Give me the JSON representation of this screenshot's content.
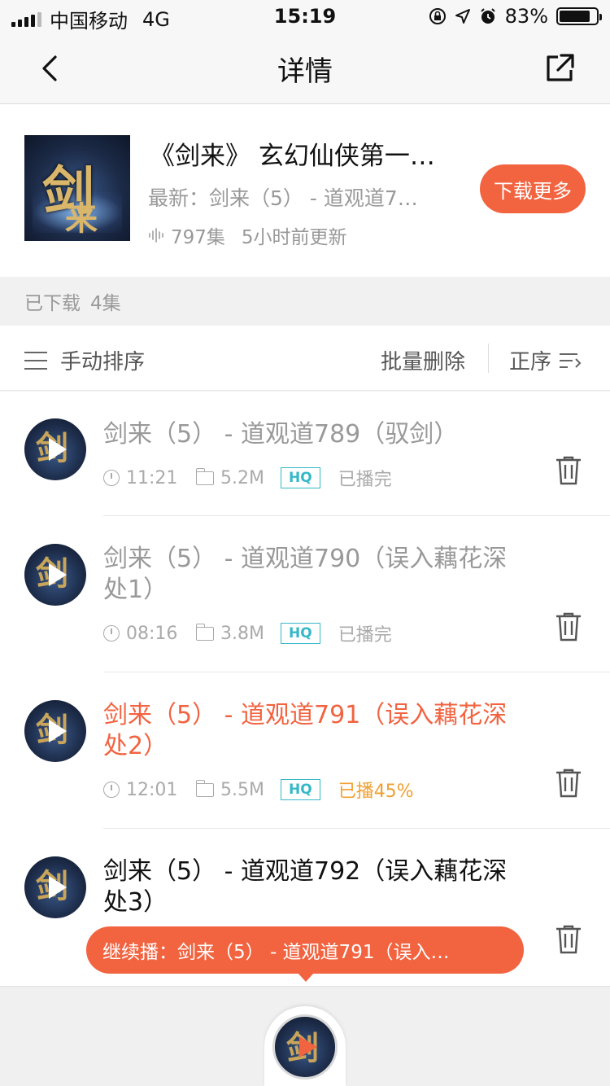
{
  "status_bar": {
    "carrier": "中国移动",
    "network": "4G",
    "time": "15:19",
    "battery": "83%",
    "battery_level": 0.83
  },
  "nav": {
    "title": "详情",
    "back_icon": "chevron-left-icon",
    "share_icon": "share-external-icon"
  },
  "album": {
    "title": "《剑来》 玄幻仙侠第一…",
    "latest": "最新：剑来（5） - 道观道7…",
    "episode_count": "797集",
    "updated": "5小时前更新",
    "download_more": "下载更多",
    "cover_glyph": "剑",
    "cover_glyph2": "来"
  },
  "downloaded": {
    "label": "已下载",
    "count": "4集"
  },
  "toolbar": {
    "manual_sort": "手动排序",
    "batch_delete": "批量删除",
    "order": "正序"
  },
  "episodes": [
    {
      "title": "剑来（5） - 道观道789（驭剑）",
      "duration": "11:21",
      "size": "5.2M",
      "quality": "HQ",
      "status": "已播完"
    },
    {
      "title": "剑来（5） - 道观道790（误入藕花深处1）",
      "duration": "08:16",
      "size": "3.8M",
      "quality": "HQ",
      "status": "已播完"
    },
    {
      "title": "剑来（5） - 道观道791（误入藕花深处2）",
      "duration": "12:01",
      "size": "5.5M",
      "quality": "HQ",
      "status": "已播45%"
    },
    {
      "title": "剑来（5） - 道观道792（误入藕花深处3）"
    }
  ],
  "continue_tip": "继续播：剑来（5） - 道观道791（误入…",
  "colors": {
    "accent": "#f26340",
    "hq": "#35b8c8",
    "partial": "#f0a030"
  }
}
